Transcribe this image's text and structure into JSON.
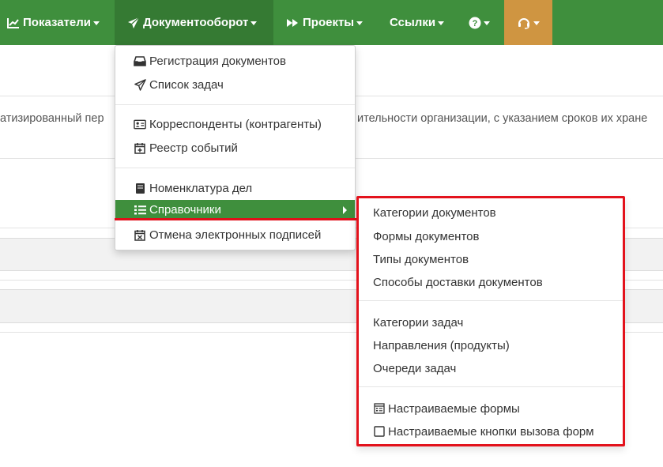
{
  "navbar": {
    "indicators_label": "Показатели",
    "docflow_label": "Документооборот",
    "projects_label": "Проекты",
    "links_label": "Ссылки"
  },
  "background": {
    "partial_text_left": "атизированный пер",
    "partial_text_right": "ительности организации, с указанием сроков их хране"
  },
  "docflow_menu": {
    "items": [
      {
        "label": "Регистрация документов",
        "icon": "inbox-icon"
      },
      {
        "label": "Список задач",
        "icon": "paper-plane-icon"
      },
      {
        "label": "Корреспонденты (контрагенты)",
        "icon": "address-card-icon"
      },
      {
        "label": "Реестр событий",
        "icon": "calendar-plus-icon"
      },
      {
        "label": "Номенклатура дел",
        "icon": "book-icon"
      },
      {
        "label": "Справочники",
        "icon": "list-icon"
      },
      {
        "label": "Отмена электронных подписей",
        "icon": "calendar-times-icon"
      }
    ],
    "highlight_color": "#3f8f3d"
  },
  "reference_submenu": {
    "items": [
      {
        "label": "Категории документов"
      },
      {
        "label": "Формы документов"
      },
      {
        "label": "Типы документов"
      },
      {
        "label": "Способы доставки документов"
      },
      {
        "label": "Категории задач"
      },
      {
        "label": "Направления (продукты)"
      },
      {
        "label": "Очереди задач"
      },
      {
        "label": "Настраиваемые формы",
        "icon": "form-icon"
      },
      {
        "label": "Настраиваемые кнопки вызова форм",
        "icon": "square-icon"
      }
    ],
    "border_color": "#e3121c"
  },
  "colors": {
    "navbar_bg": "#3f8f3d",
    "navbar_active": "#357a33",
    "support_bg": "#cf9541",
    "highlight_red": "#e0101a"
  }
}
